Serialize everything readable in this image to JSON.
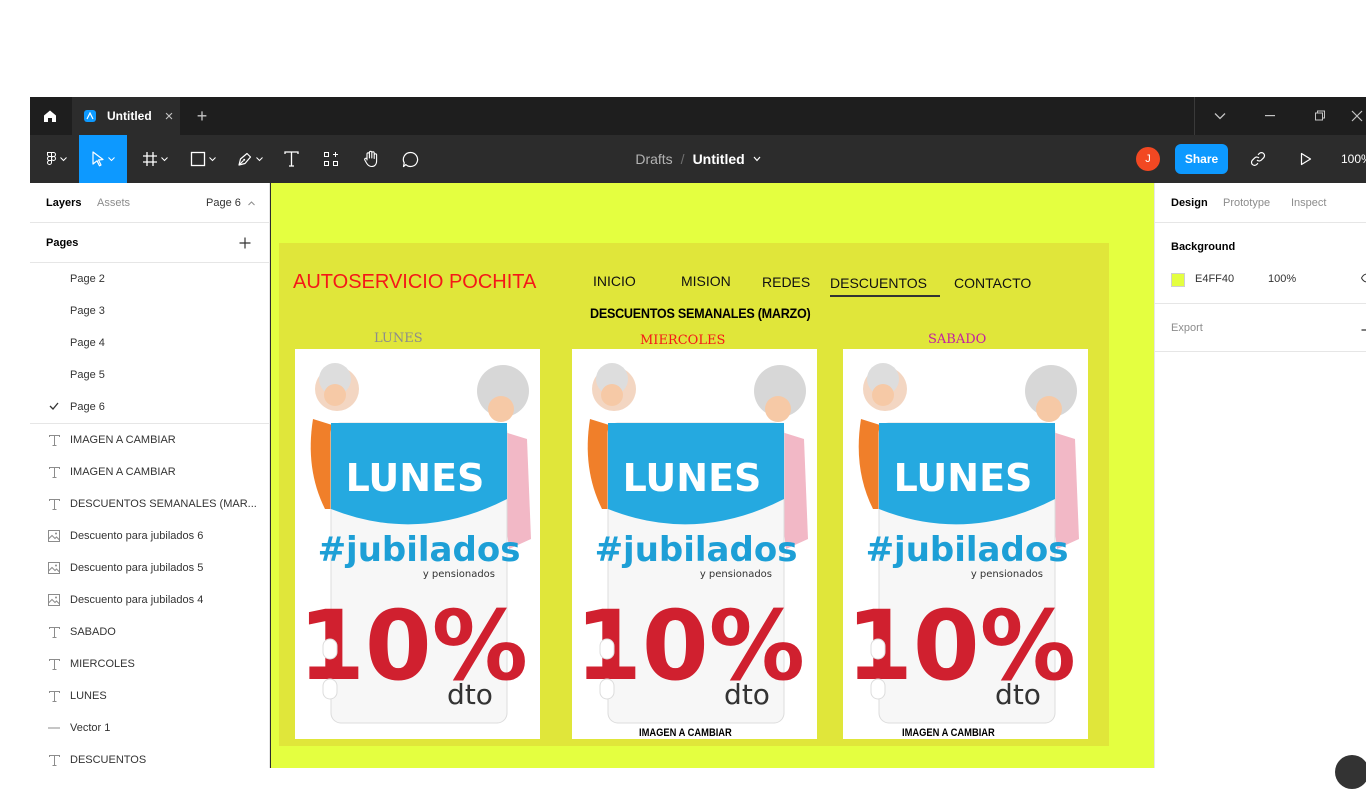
{
  "colors": {
    "accent": "#0d99ff",
    "canvas_background": "#e4ff40",
    "frame_background": "#e0e63a",
    "brand_red": "#f41818",
    "avatar": "#f24822"
  },
  "titlebar": {
    "home_icon": "home-icon",
    "tab_title": "Untitled",
    "tab_close": "×",
    "new_tab": "+"
  },
  "toolbar": {
    "tools": [
      "figma-menu-icon",
      "move-tool-icon",
      "frame-tool-icon",
      "rectangle-tool-icon",
      "pen-tool-icon",
      "text-tool-icon",
      "resources-icon",
      "hand-tool-icon",
      "comment-icon"
    ],
    "breadcrumb": {
      "folder": "Drafts",
      "separator": "/",
      "file": "Untitled"
    },
    "avatar_initial": "J",
    "share_label": "Share",
    "zoom": "100%"
  },
  "left_panel": {
    "tabs": {
      "layers": "Layers",
      "assets": "Assets"
    },
    "current_page": "Page 6",
    "pages_title": "Pages",
    "pages": [
      {
        "label": "Page 2",
        "selected": false
      },
      {
        "label": "Page 3",
        "selected": false
      },
      {
        "label": "Page 4",
        "selected": false
      },
      {
        "label": "Page 5",
        "selected": false
      },
      {
        "label": "Page 6",
        "selected": true
      }
    ],
    "layers": [
      {
        "label": "IMAGEN A CAMBIAR",
        "type": "text"
      },
      {
        "label": "IMAGEN A CAMBIAR",
        "type": "text"
      },
      {
        "label": "DESCUENTOS SEMANALES (MAR...",
        "type": "text"
      },
      {
        "label": "Descuento para jubilados 6",
        "type": "image"
      },
      {
        "label": "Descuento para jubilados 5",
        "type": "image"
      },
      {
        "label": "Descuento para jubilados 4",
        "type": "image"
      },
      {
        "label": "SABADO",
        "type": "text"
      },
      {
        "label": "MIERCOLES",
        "type": "text"
      },
      {
        "label": "LUNES",
        "type": "text"
      },
      {
        "label": "Vector 1",
        "type": "vector"
      },
      {
        "label": "DESCUENTOS",
        "type": "text"
      }
    ]
  },
  "canvas": {
    "brand": "AUTOSERVICIO POCHITA",
    "nav": [
      "INICIO",
      "MISION",
      "REDES",
      "DESCUENTOS",
      "CONTACTO"
    ],
    "title": "DESCUENTOS SEMANALES (MARZO)",
    "days": [
      {
        "label": "LUNES",
        "color": "#8c8c8c"
      },
      {
        "label": "MIERCOLES",
        "color": "#f41818"
      },
      {
        "label": "SABADO",
        "color": "#c21fa3"
      }
    ],
    "promo": {
      "day": "LUNES",
      "hashtag": "#jubilados",
      "subtitle": "y pensionados",
      "discount": "10%",
      "unit": "dto"
    },
    "captions": [
      "IMAGEN A CAMBIAR",
      "IMAGEN A CAMBIAR"
    ]
  },
  "right_panel": {
    "tabs": {
      "design": "Design",
      "prototype": "Prototype",
      "inspect": "Inspect"
    },
    "background_title": "Background",
    "background_hex": "E4FF40",
    "background_opacity": "100%",
    "export_title": "Export"
  }
}
